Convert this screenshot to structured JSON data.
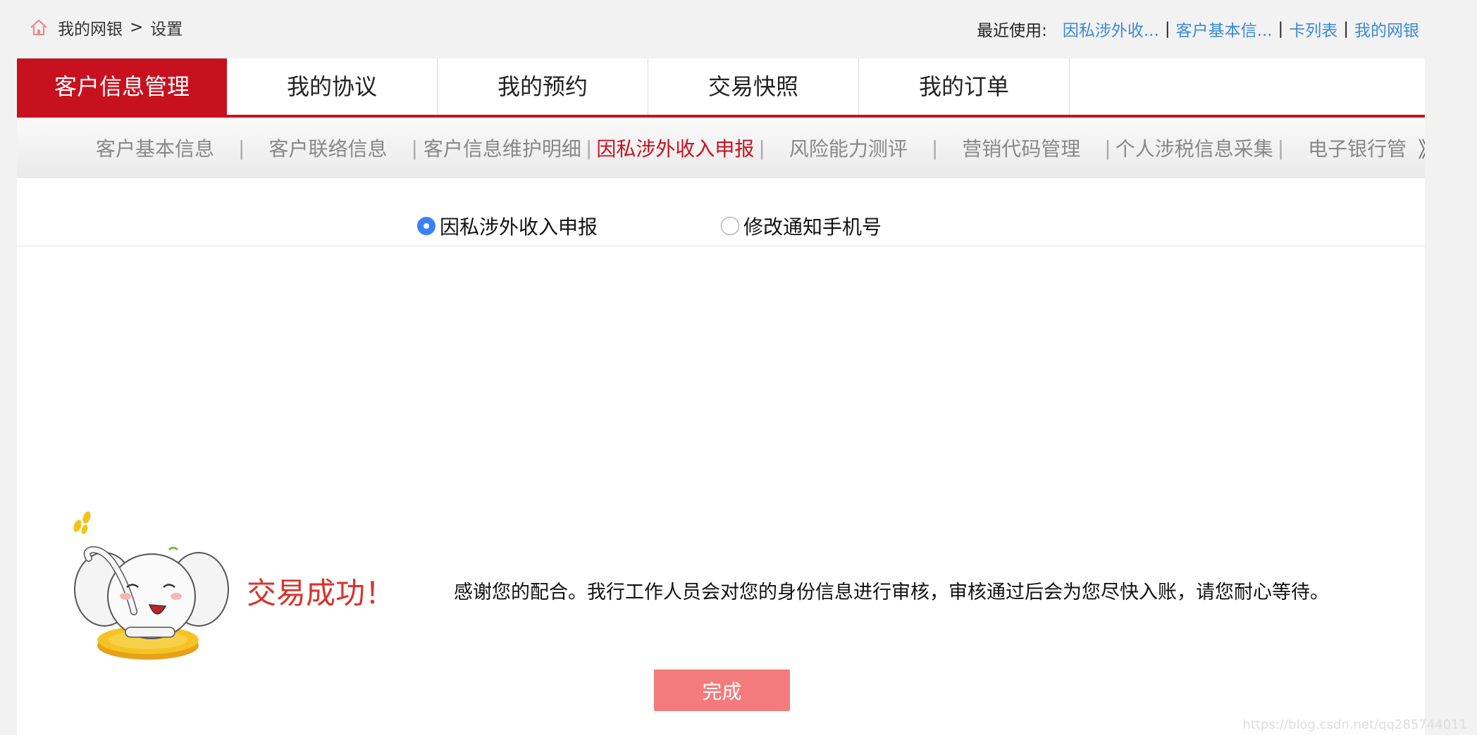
{
  "breadcrumb": {
    "root": "我的网银",
    "separator": ">",
    "current": "设置"
  },
  "recent": {
    "label": "最近使用:",
    "links": [
      "因私涉外收...",
      "客户基本信...",
      "卡列表",
      "我的网银"
    ]
  },
  "tabs": [
    "客户信息管理",
    "我的协议",
    "我的预约",
    "交易快照",
    "我的订单"
  ],
  "subnav": {
    "items": [
      "客户基本信息",
      "客户联络信息",
      "客户信息维护明细",
      "因私涉外收入申报",
      "风险能力测评",
      "营销代码管理",
      "个人涉税信息采集",
      "电子银行管"
    ],
    "active": "因私涉外收入申报",
    "more": "》"
  },
  "radios": {
    "option1": "因私涉外收入申报",
    "option2": "修改通知手机号",
    "selected": "因私涉外收入申报"
  },
  "result": {
    "title": "交易成功！",
    "message": "感谢您的配合。我行工作人员会对您的身份信息进行审核，审核通过后会为您尽快入账，请您耐心等待。",
    "button": "完成"
  },
  "watermark": "https://blog.csdn.net/qq285744011",
  "colors": {
    "brand_red": "#c8111f",
    "link_blue": "#3a8bd6",
    "button_pink": "#f47b7b",
    "success_red": "#d8322b",
    "radio_blue": "#3b82f6"
  }
}
